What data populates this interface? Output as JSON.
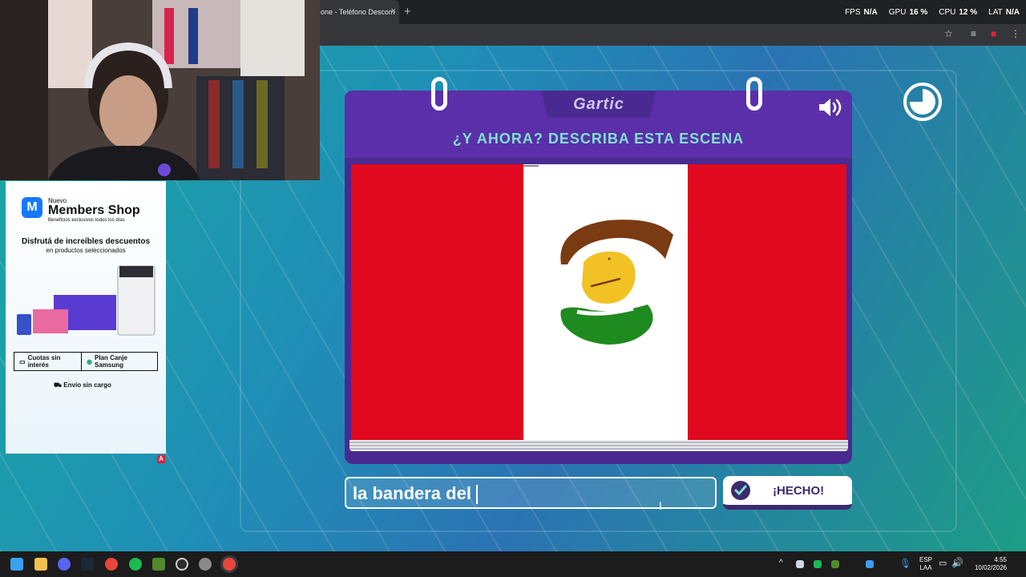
{
  "browser": {
    "tab_title": "one - Teléfono Descom",
    "tab_close": "×",
    "new_tab": "+",
    "perf": [
      {
        "label": "FPS",
        "value": "N/A"
      },
      {
        "label": "GPU",
        "value": "16 %"
      },
      {
        "label": "CPU",
        "value": "12 %"
      },
      {
        "label": "LAT",
        "value": "N/A"
      }
    ]
  },
  "game": {
    "logo": "Gartic",
    "prompt": "¿Y AHORA? DESCRIBA ESTA ESCENA",
    "answer_value": "la bandera del",
    "done_label": "¡HECHO!"
  },
  "ad": {
    "new_label": "Nuevo",
    "brand": "Members Shop",
    "tagline": "Beneficios exclusivos todos los días",
    "headline": "Disfrutá de increíbles descuentos",
    "subheadline": "en productos seleccionados",
    "option1": "Cuotas sin interés",
    "option2": "Plan Canje Samsung",
    "shipping": "Envío sin cargo",
    "badge": "A"
  },
  "taskbar": {
    "lang_line1": "ESP",
    "lang_line2": "LAA",
    "time": "4:55",
    "date": "10/02/2026"
  }
}
